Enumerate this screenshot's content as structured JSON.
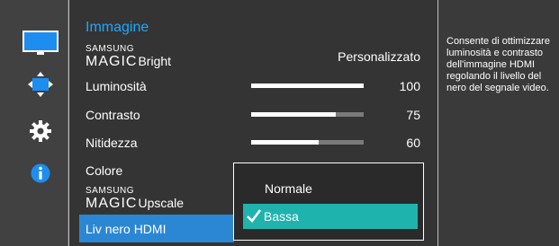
{
  "menu": {
    "title": "Immagine",
    "items": [
      {
        "brand": "SAMSUNG",
        "magic": "MAGIC",
        "label": "Bright",
        "value": "Personalizzato"
      },
      {
        "label": "Luminosità",
        "value": "100",
        "level": 1.0
      },
      {
        "label": "Contrasto",
        "value": "75",
        "level": 0.75
      },
      {
        "label": "Nitidezza",
        "value": "60",
        "level": 0.6
      },
      {
        "label": "Colore"
      },
      {
        "brand": "SAMSUNG",
        "magic": "MAGIC",
        "label": "Upscale"
      },
      {
        "label": "Liv nero HDMI"
      }
    ]
  },
  "submenu": {
    "options": [
      "Normale",
      "Bassa"
    ],
    "selected": "Bassa"
  },
  "help": {
    "text": "Consente di ottimizzare luminosità e contrasto dell'immagine HDMI regolando il livello del nero del segnale video."
  },
  "sidebar": {
    "icons": [
      "picture-icon",
      "screen-size-icon",
      "gear-icon",
      "info-icon"
    ]
  },
  "colors": {
    "title_accent": "#1ea7ff",
    "selected_row": "#2b87d3",
    "selected_option": "#1fb3ae",
    "info_icon": "#1e8df0"
  }
}
